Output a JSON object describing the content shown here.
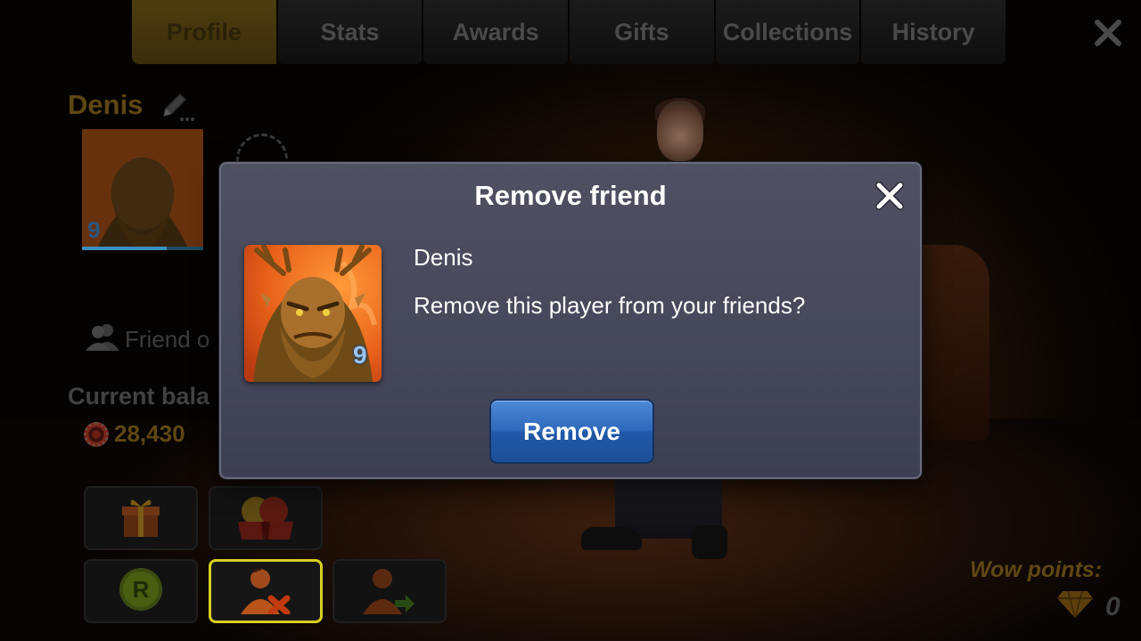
{
  "tabs": [
    {
      "label": "Profile",
      "active": true
    },
    {
      "label": "Stats",
      "active": false
    },
    {
      "label": "Awards",
      "active": false
    },
    {
      "label": "Gifts",
      "active": false
    },
    {
      "label": "Collections",
      "active": false
    },
    {
      "label": "History",
      "active": false
    }
  ],
  "profile": {
    "name": "Denis",
    "level": "9",
    "friend_status": "Friend o",
    "balance_label": "Current bala",
    "balance_value": "28,430"
  },
  "wow": {
    "label": "Wow points:",
    "value": "0"
  },
  "modal": {
    "title": "Remove friend",
    "player_name": "Denis",
    "player_level": "9",
    "message": "Remove this player from your friends?",
    "remove_label": "Remove"
  },
  "icons": {
    "close_main": "close-icon",
    "edit_name": "pencil-icon",
    "friends": "friends-icon",
    "chip": "chip-icon",
    "gift": "gift-icon",
    "coins": "coins-gift-icon",
    "roulette": "r-coin-icon",
    "remove_friend": "remove-friend-icon",
    "transfer": "transfer-icon",
    "diamond": "diamond-icon",
    "modal_close": "close-icon"
  },
  "colors": {
    "accent_gold": "#e4a92a",
    "remove_button": "#2f69bb",
    "highlight": "#d8d021",
    "level_blue": "#9cc4f0"
  }
}
